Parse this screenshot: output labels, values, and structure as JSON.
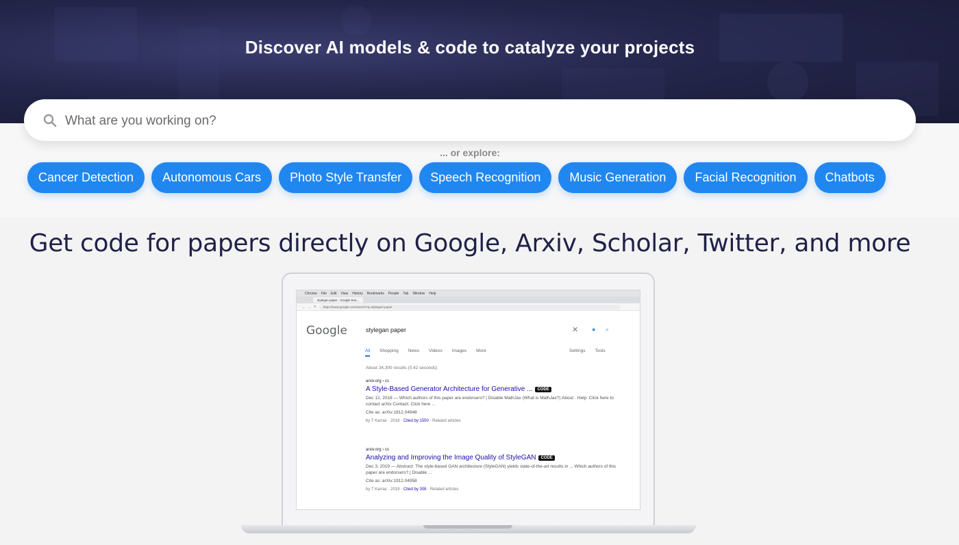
{
  "hero": {
    "title": "Discover AI models & code to catalyze your projects"
  },
  "search": {
    "placeholder": "What are you working on?",
    "icon": "search-icon"
  },
  "explore": {
    "label": "... or explore:",
    "topics": [
      "Cancer Detection",
      "Autonomous Cars",
      "Photo Style Transfer",
      "Speech Recognition",
      "Music Generation",
      "Facial Recognition",
      "Chatbots"
    ]
  },
  "promo": {
    "title": "Get code for papers directly on Google, Arxiv, Scholar, Twitter, and more"
  },
  "screenshot": {
    "menubar": [
      "Chrome",
      "File",
      "Edit",
      "View",
      "History",
      "Bookmarks",
      "People",
      "Tab",
      "Window",
      "Help"
    ],
    "tab_title": "stylegan paper - Google Sea...",
    "url": "https://www.google.com/search?q=stylegan+paper",
    "google_logo": "Google",
    "query": "stylegan paper",
    "tabs": [
      "All",
      "Shopping",
      "News",
      "Videos",
      "Images",
      "More"
    ],
    "tools": [
      "Settings",
      "Tools"
    ],
    "stats": "About 34,300 results (0.42 seconds)",
    "results": [
      {
        "cite": "arxiv.org › cs",
        "title": "A Style-Based Generator Architecture for Generative ...",
        "badge": "CODE",
        "snippet": "Dec 12, 2018 — Which authors of this paper are endorsers? | Disable MathJax (What is MathJax?) About · Help. Click here to contact arXiv Contact; Click here ...",
        "arxiv": "Cite as: arXiv:1812.04948",
        "author": "by T Karras · 2018 ·",
        "cited": "Cited by 1550",
        "related": "· Related articles"
      },
      {
        "cite": "arxiv.org › cs",
        "title": "Analyzing and Improving the Image Quality of StyleGAN",
        "badge": "CODE",
        "snippet": "Dec 3, 2019 — Abstract: The style-based GAN architecture (StyleGAN) yields state-of-the-art results in ... Which authors of this paper are endorsers? | Disable ...",
        "arxiv": "Cite as: arXiv:1912.04958",
        "author": "by T Karras · 2019 ·",
        "cited": "Cited by 308",
        "related": "· Related articles"
      }
    ]
  },
  "colors": {
    "hero_bg": "#23254a",
    "pill_bg": "#2187f0",
    "promo_text": "#1f2147"
  }
}
